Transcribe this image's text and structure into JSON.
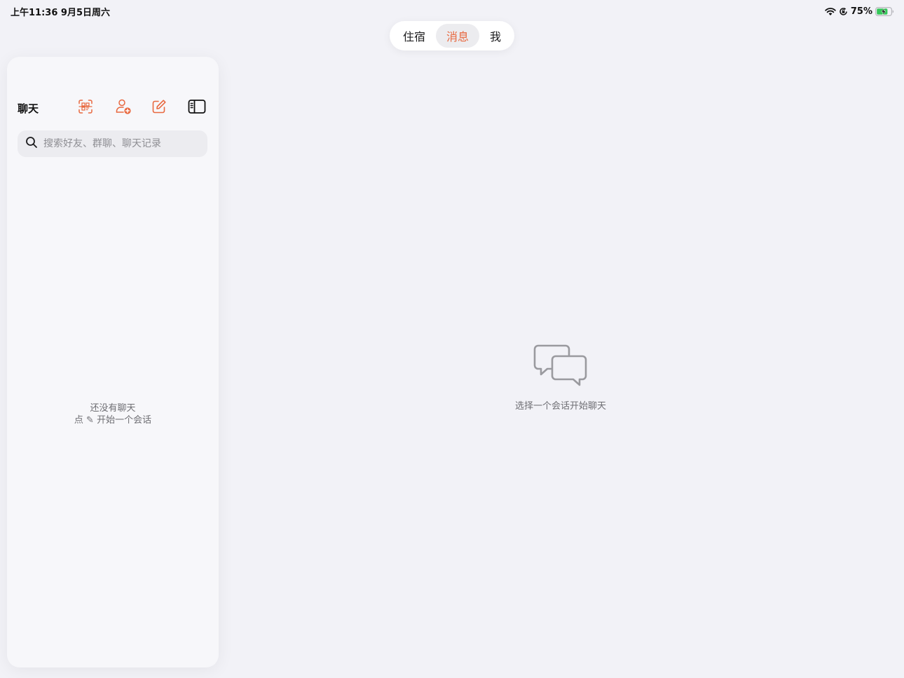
{
  "status_bar": {
    "time_date": "上午11:36   9月5日周六",
    "battery_percent": "75%",
    "icons": [
      "wifi-icon",
      "orientation-lock-icon",
      "battery-charging-icon"
    ]
  },
  "top_tabs": [
    {
      "label": "住宿",
      "selected": false
    },
    {
      "label": "消息",
      "selected": true
    },
    {
      "label": "我",
      "selected": false
    }
  ],
  "sidebar": {
    "title": "聊天",
    "header_icons": [
      "scan-qr-icon",
      "add-friend-icon",
      "compose-icon",
      "toggle-sidebar-icon"
    ],
    "search": {
      "placeholder": "搜索好友、群聊、聊天记录",
      "value": ""
    },
    "empty_line1": "还没有聊天",
    "empty_line2": "点 ✎ 开始一个会话"
  },
  "main": {
    "empty_text": "选择一个会话开始聊天",
    "empty_icon": "chat-bubbles-icon"
  },
  "colors": {
    "accent": "#e8683f",
    "background": "#f2f2f7",
    "sidebar_bg": "#f7f7fa",
    "muted_text": "#6e6e73"
  }
}
